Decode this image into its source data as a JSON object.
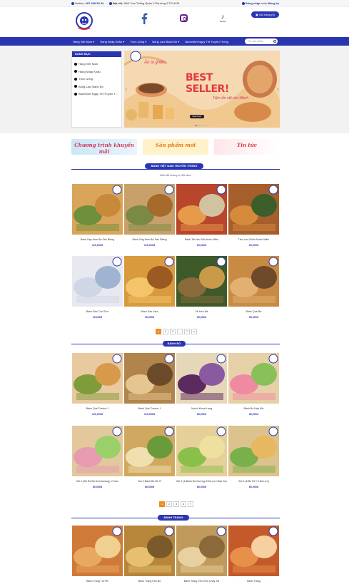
{
  "topbar": {
    "hotline_label": "Hotline:",
    "hotline": "097 908 50 54",
    "address_label": "Địa chỉ:",
    "address": "89/5 Cao Thắng Quận 3 Phường 3 TP.HCM",
    "login": "Đăng nhập",
    "or": "hoặc",
    "register": "Đăng ký"
  },
  "header": {
    "tiktok_label": "TikTok",
    "cart_label": "Giỏ hàng (0)"
  },
  "nav": {
    "items": [
      "Hàng Việt Nam ▾",
      "Hàng Nhập Khẩu ▾",
      "Thức Uống ▾",
      "Bông Lan/ Bánh Bò ▾",
      "Bánh/Mứt Ngày Tết Truyền Thống"
    ],
    "search_placeholder": "Tìm sản phẩm..."
  },
  "sidebar": {
    "title": "DANH MỤC",
    "items": [
      "Hàng Việt Nam",
      "Hàng Nhập Khẩu",
      "Thức Uống",
      "Bông Lan/ Bánh Bò",
      "Bánh/Mứt Ngày Tết Truyền T..."
    ]
  },
  "banner": {
    "tagline": "Ăn là ghiền",
    "best": "BEST",
    "seller": "SELLER!",
    "shop": "Tiệm Ăn vặt chú Mành",
    "cta": "XEM NGAY"
  },
  "promos": [
    "Chương trình khuyến mãi",
    "Sản phẩm mới",
    "Tin tức"
  ],
  "section1": {
    "title": "BÁNH VIỆT NAM TRUYỀN THỐNG",
    "subtitle": "Đậm đà hương vị Việt Nam",
    "products": [
      {
        "name": "Bánh Kẹp Kem Ăn Sầu Riêng",
        "price": "120,000đ"
      },
      {
        "name": "Bánh Ống Kem Bơ Sầu Riêng",
        "price": "120,000đ"
      },
      {
        "name": "Bánh Tai Heo Sốt Nước Mắm",
        "price": "60,000đ"
      },
      {
        "name": "Tiên Lao Chiên Nước Mắm",
        "price": "60,000đ"
      },
      {
        "name": "Bánh Bao Tuồi Thơ",
        "price": "30,000đ"
      },
      {
        "name": "Bánh Sầu Kem",
        "price": "50,000đ"
      },
      {
        "name": "Tai Heo Mè",
        "price": "50,000đ"
      },
      {
        "name": "Bánh Que Bơ",
        "price": "50,000đ"
      }
    ],
    "pages": [
      "1",
      "2",
      "3",
      "...",
      "7",
      "»"
    ]
  },
  "section2": {
    "title": "BÁNH BÒ",
    "products": [
      {
        "name": "Bánh Quế Combo 1",
        "price": "120,000đ"
      },
      {
        "name": "Bánh Quế Combo 1",
        "price": "120,000đ"
      },
      {
        "name": "Mochi Khoai Lang",
        "price": "80,000đ"
      },
      {
        "name": "Bánh Bò Hấp Mix",
        "price": "80,000đ"
      },
      {
        "name": "Set 1 (Bò Rế Bò Dừa Nướng) Vị Cac",
        "price": "80,000đ"
      },
      {
        "name": "Set 2 Bánh Bò Rế Ồ",
        "price": "80,000đ"
      },
      {
        "name": "Set 3 (6 Bánh Bò Nướng/ 6 Da Lợn Đậu Xanh)",
        "price": "80,000đ"
      },
      {
        "name": "Set 4 (6 Bò Rế / 6 Da Lợn)",
        "price": "80,000đ"
      }
    ],
    "pages": [
      "1",
      "2",
      "3",
      "4",
      "»"
    ]
  },
  "section3": {
    "title": "BÁNH TRÁNG",
    "products": [
      {
        "name": "Bánh Tráng Tỏi Phi"
      },
      {
        "name": "Bánh Tráng Khô Bò"
      },
      {
        "name": "Bánh Tráng Tôm Khô Cháy Tỏi"
      },
      {
        "name": "Bánh Tráng"
      }
    ]
  },
  "colors": {
    "brand": "#2a35b0",
    "accent": "#f08a24",
    "price": "#2a35b0"
  }
}
